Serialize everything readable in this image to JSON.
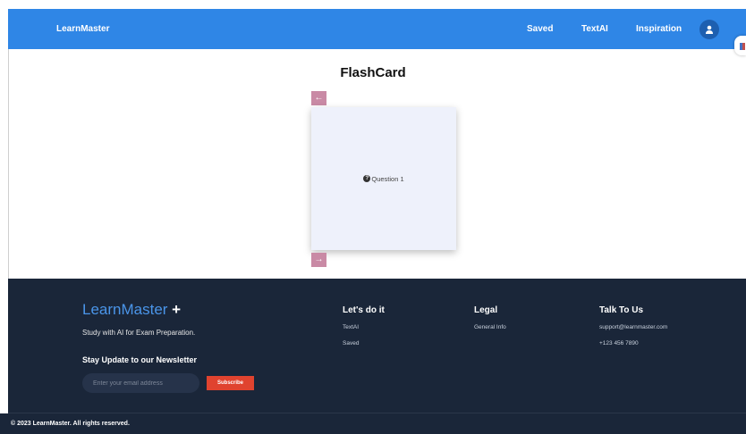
{
  "navbar": {
    "brand": "LearnMaster",
    "links": [
      "Saved",
      "TextAI",
      "Inspiration"
    ]
  },
  "main": {
    "title": "FlashCard",
    "prev_arrow": "←",
    "next_arrow": "→",
    "card_text": "Question 1",
    "question_icon": "?"
  },
  "footer": {
    "logo": "LearnMaster",
    "logo_plus": "+",
    "tagline": "Study with AI for Exam Preparation.",
    "newsletter_title": "Stay Update to our Newsletter",
    "email_placeholder": "Enter your email address",
    "subscribe_label": "Subscribe",
    "col1": {
      "title": "Let's do it",
      "links": [
        "TextAI",
        "Saved"
      ]
    },
    "col2": {
      "title": "Legal",
      "links": [
        "General Info"
      ]
    },
    "col3": {
      "title": "Talk To Us",
      "links": [
        "support@learnmaster.com",
        "+123 456 7890"
      ]
    },
    "copyright": "© 2023 LearnMaster. All rights reserved."
  },
  "colors": {
    "navbar": "#2f86e6",
    "footer": "#1a2639",
    "arrow_button": "#c98aa5",
    "card": "#eef1fb",
    "subscribe": "#e0432f",
    "logo_blue": "#4a95e9"
  }
}
